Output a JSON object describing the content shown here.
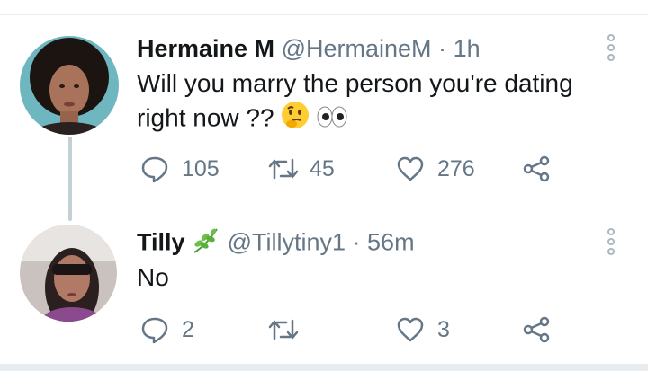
{
  "tweets": [
    {
      "name": "Hermaine M",
      "handle": "@HermaineM",
      "separator": "·",
      "time": "1h",
      "text_line1": "Will you marry the person you're dating",
      "text_line2": "right now ??",
      "emojis": [
        "thinking-face-emoji",
        "eyes-emoji"
      ],
      "replies": "105",
      "retweets": "45",
      "likes": "276"
    },
    {
      "name": "Tilly",
      "handle": "@Tillytiny1",
      "separator": "·",
      "time": "56m",
      "text": "No",
      "name_emoji": "herb-emoji",
      "replies": "2",
      "retweets": "",
      "likes": "3"
    }
  ],
  "colors": {
    "text": "#14171a",
    "secondary": "#657786",
    "divider": "#e6ecf0",
    "thread_line": "#c4cfd6"
  }
}
